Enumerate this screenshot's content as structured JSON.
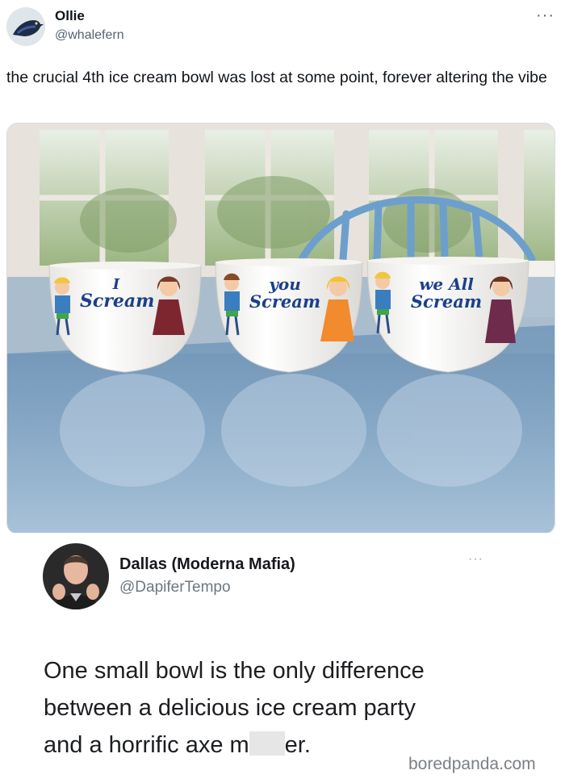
{
  "tweet": {
    "author_name": "Ollie",
    "author_handle": "@whalefern",
    "text": "the crucial 4th ice cream bowl was lost at some point, forever altering the vibe"
  },
  "bowls": [
    {
      "line1": "I",
      "line2": "Scream"
    },
    {
      "line1": "you",
      "line2": "Scream"
    },
    {
      "line1": "we All",
      "line2": "Scream"
    }
  ],
  "quoted": {
    "author_name": "Dallas (Moderna Mafia)",
    "author_handle": "@DapiferTempo",
    "text_line1": "One small bowl is the only difference",
    "text_line2": "between a delicious ice cream party",
    "text_line3_before": "and a horrific axe m",
    "text_line3_after": "er."
  },
  "watermark": "boredpanda.com",
  "colors": {
    "text": "#0f1419",
    "secondary": "#536471",
    "bowl_text": "#1b3f8a"
  }
}
